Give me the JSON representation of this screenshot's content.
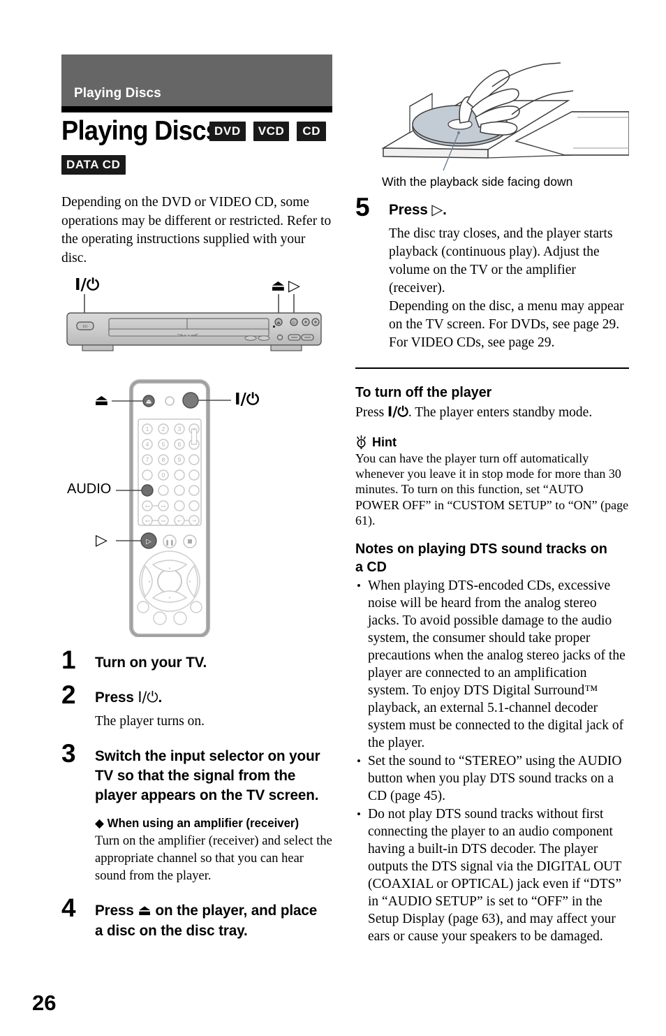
{
  "page": {
    "number": "26",
    "running_header": "Playing Discs",
    "title": "Playing Discs",
    "header_band_color": "#666666",
    "rule_color": "#000000"
  },
  "disc_badges_row1": [
    {
      "label": "DVD",
      "name": "badge-dvd"
    },
    {
      "label": "VCD",
      "name": "badge-vcd"
    },
    {
      "label": "CD",
      "name": "badge-cd"
    }
  ],
  "disc_badges_row2": [
    {
      "label": "DATA CD",
      "name": "badge-data-cd"
    }
  ],
  "intro": "Depending on the DVD or VIDEO CD, some operations may be different or restricted. Refer to the operating instructions supplied with your disc.",
  "figures": {
    "front_panel": {
      "name": "front-panel-illustration",
      "callouts": [
        {
          "label": "I/⏻",
          "name": "callout-power"
        },
        {
          "label": "⏏",
          "name": "callout-eject"
        },
        {
          "label": "▷",
          "name": "callout-play"
        }
      ]
    },
    "remote": {
      "name": "remote-control-illustration",
      "callouts": [
        {
          "label": "⏏",
          "name": "callout-eject"
        },
        {
          "label": "I/⏻",
          "name": "callout-power"
        },
        {
          "label": "AUDIO",
          "name": "callout-audio"
        },
        {
          "label": "▷",
          "name": "callout-play"
        }
      ],
      "keypad_digits": [
        "1",
        "2",
        "3",
        "4",
        "5",
        "6",
        "7",
        "8",
        "9",
        "0"
      ],
      "volume_keys": [
        "+",
        "−"
      ]
    },
    "disc_tray": {
      "name": "disc-tray-illustration",
      "caption": "With the playback side facing down"
    }
  },
  "steps": [
    {
      "num": "1",
      "title": "Turn on your TV.",
      "body": ""
    },
    {
      "num": "2",
      "title_prefix": "Press ",
      "title_symbol": "I/⏻",
      "title_suffix": ".",
      "title": "Press I/⏻.",
      "body": "The player turns on."
    },
    {
      "num": "3",
      "title": "Switch the input selector on your TV so that the signal from the player appears on the TV screen.",
      "sub_head": "◆ When using an amplifier (receiver)",
      "sub_body": "Turn on the amplifier (receiver) and select the appropriate channel so that you can hear sound from the player."
    },
    {
      "num": "4",
      "title_prefix": "Press ",
      "title_symbol": "⏏",
      "title_suffix": " on the player, and place a disc on the disc tray.",
      "title": "Press ⏏ on the player, and place a disc on the disc tray.",
      "body": ""
    },
    {
      "num": "5",
      "title_prefix": "Press ",
      "title_symbol": "▷",
      "title_suffix": ".",
      "title": "Press ▷.",
      "body": "The disc tray closes, and the player starts playback (continuous play). Adjust the volume on the TV or the amplifier (receiver).\nDepending on the disc, a menu may appear on the TV screen. For DVDs, see page 29. For VIDEO CDs, see page 29."
    }
  ],
  "turn_off": {
    "heading": "To turn off the player",
    "body_prefix": "Press ",
    "body_symbol": "I/⏻",
    "body_suffix": ". The player enters standby mode.",
    "body": "Press I/⏻. The player enters standby mode."
  },
  "hint": {
    "label": "Hint",
    "icon": "lightbulb-icon",
    "body": "You can have the player turn off automatically whenever you leave it in stop mode for more than 30 minutes. To turn on this function, set “AUTO POWER OFF” in “CUSTOM SETUP” to “ON” (page 61)."
  },
  "dts_notes": {
    "heading": "Notes on playing DTS sound tracks on a CD",
    "items": [
      "When playing DTS-encoded CDs, excessive noise will be heard from the analog stereo jacks. To avoid possible damage to the audio system, the consumer should take proper precautions when the analog stereo jacks of the player are connected to an amplification system. To enjoy DTS Digital Surround™ playback, an external 5.1-channel decoder system must be connected to the digital jack of the player.",
      "Set the sound to “STEREO” using the AUDIO button when you play DTS sound tracks on a CD (page 45).",
      "Do not play DTS sound tracks without first connecting the player to an audio component having a built-in DTS decoder. The player outputs the DTS signal via the DIGITAL OUT (COAXIAL or OPTICAL) jack even if “DTS” in “AUDIO SETUP” is set to “OFF” in the Setup Display (page 63), and may affect your ears or cause your speakers to be damaged."
    ]
  }
}
